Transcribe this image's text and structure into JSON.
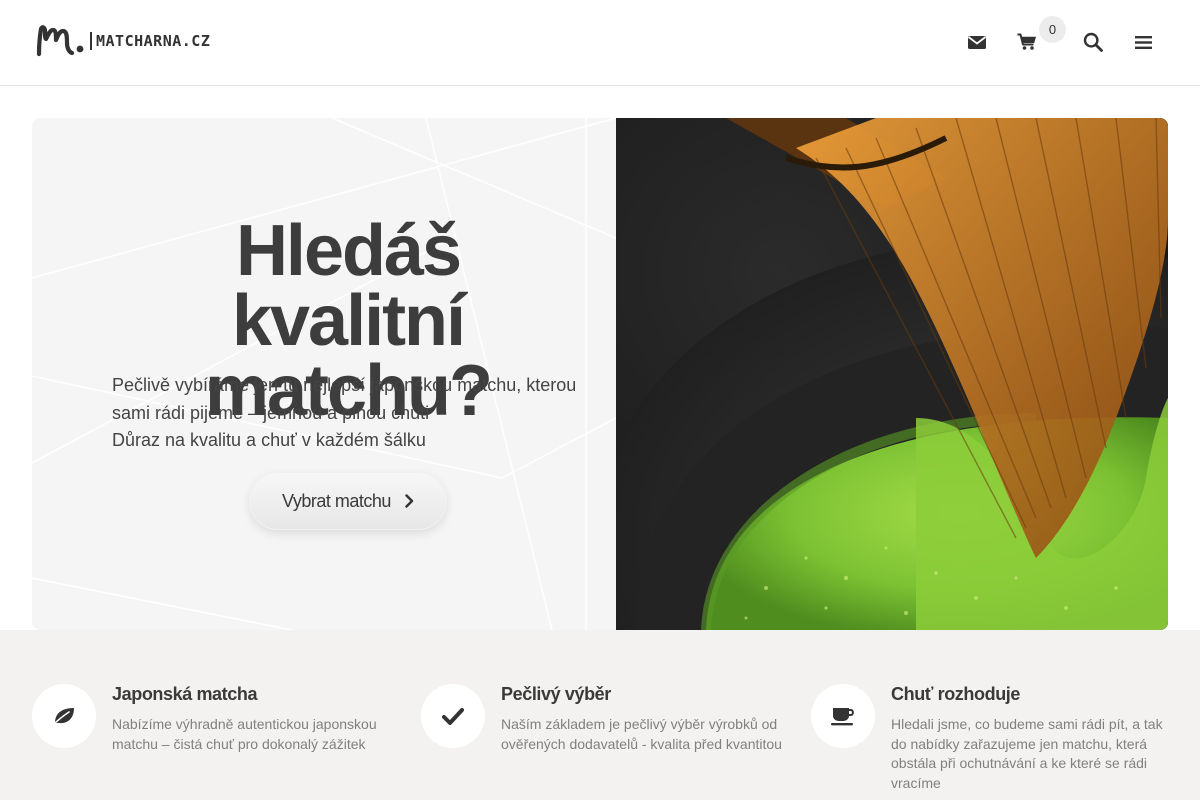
{
  "header": {
    "brand": "MATCHARNA.CZ",
    "cart_count": "0",
    "icons": [
      "envelope-icon",
      "cart-icon",
      "search-icon",
      "menu-icon"
    ]
  },
  "hero": {
    "title": "Hledáš kvalitní matchu?",
    "desc_lines": [
      "Pečlivě vybíráme jen tu nejlepší japonskou matchu, kterou",
      "sami rádi pijeme –  jemnou a plnou chuti",
      "Důraz na kvalitu a chuť v každém šálku"
    ],
    "button_label": "Vybrat matchu",
    "image": "matcha-whisk-bowl"
  },
  "features": [
    {
      "icon": "leaf-icon",
      "title": "Japonská matcha",
      "text": "Nabízíme výhradně autentickou japonskou matchu – čistá chuť pro dokonalý zážitek"
    },
    {
      "icon": "check-icon",
      "title": "Pečlivý výběr",
      "text": "Naším základem je pečlivý výběr výrobků od ověřených dodavatelů - kvalita před kvantitou"
    },
    {
      "icon": "coffee-cup-icon",
      "title": "Chuť rozhoduje",
      "text": "Hledali jsme, co budeme sami rádi pít, a tak do nabídky zařazujeme jen matchu, která obstála při ochutnávání a ke které se rádi vracíme"
    }
  ],
  "colors": {
    "feature_band": "#f3f2f0",
    "hero_left_bg": "#f6f5f5",
    "text_dark": "#3d3d3d",
    "matcha_green": "#6fb52c"
  }
}
